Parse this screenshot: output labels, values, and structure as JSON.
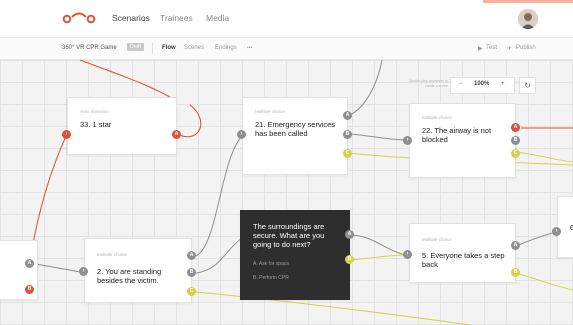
{
  "header": {
    "nav": [
      "Scenarios",
      "Trainees",
      "Media"
    ],
    "active_nav": "Scenarios"
  },
  "subbar": {
    "project": "360° VR CPR Game",
    "status_badge": "Draft",
    "tabs": [
      "Flow",
      "Scenes",
      "Endings"
    ],
    "more": "•••",
    "test_label": "Test",
    "publish_label": "Publish"
  },
  "canvas": {
    "hint": "Double-click anywhere to create a scene",
    "zoom_level": "100%",
    "zoom_out": "−",
    "zoom_in": "+",
    "refresh": "↻"
  },
  "nodes": {
    "n33": {
      "type": "Auto transition",
      "title": "33. 1 star",
      "ports": [
        "A"
      ]
    },
    "n21": {
      "type": "Multiple choice",
      "title": "21. Emergency services has been called",
      "ports": [
        "A",
        "B",
        "C"
      ]
    },
    "n22": {
      "type": "Multiple choice",
      "title": "22. The airway is not blocked",
      "ports": [
        "A",
        "B",
        "C"
      ]
    },
    "n2": {
      "type": "Multiple choice",
      "title": "2. You are standing besides the victim.",
      "ports": [
        "A",
        "B",
        "C"
      ]
    },
    "dark": {
      "title": "The surroundings are secure. What are you going to do next?",
      "options": [
        "A. Ask for space",
        "B. Perform CPR"
      ],
      "ports": [
        "A",
        "B"
      ]
    },
    "n5": {
      "type": "Multiple choice",
      "title": "5. Everyone takes a step back",
      "ports": [
        "A",
        "B"
      ]
    },
    "partial": {
      "title": "6",
      "ports": []
    },
    "left_ports": [
      "A",
      "B"
    ]
  },
  "colors": {
    "red": "#d9523a",
    "gray": "#8f8f8f",
    "yellow": "#cfd44a",
    "dark": "#2e2e2e"
  }
}
